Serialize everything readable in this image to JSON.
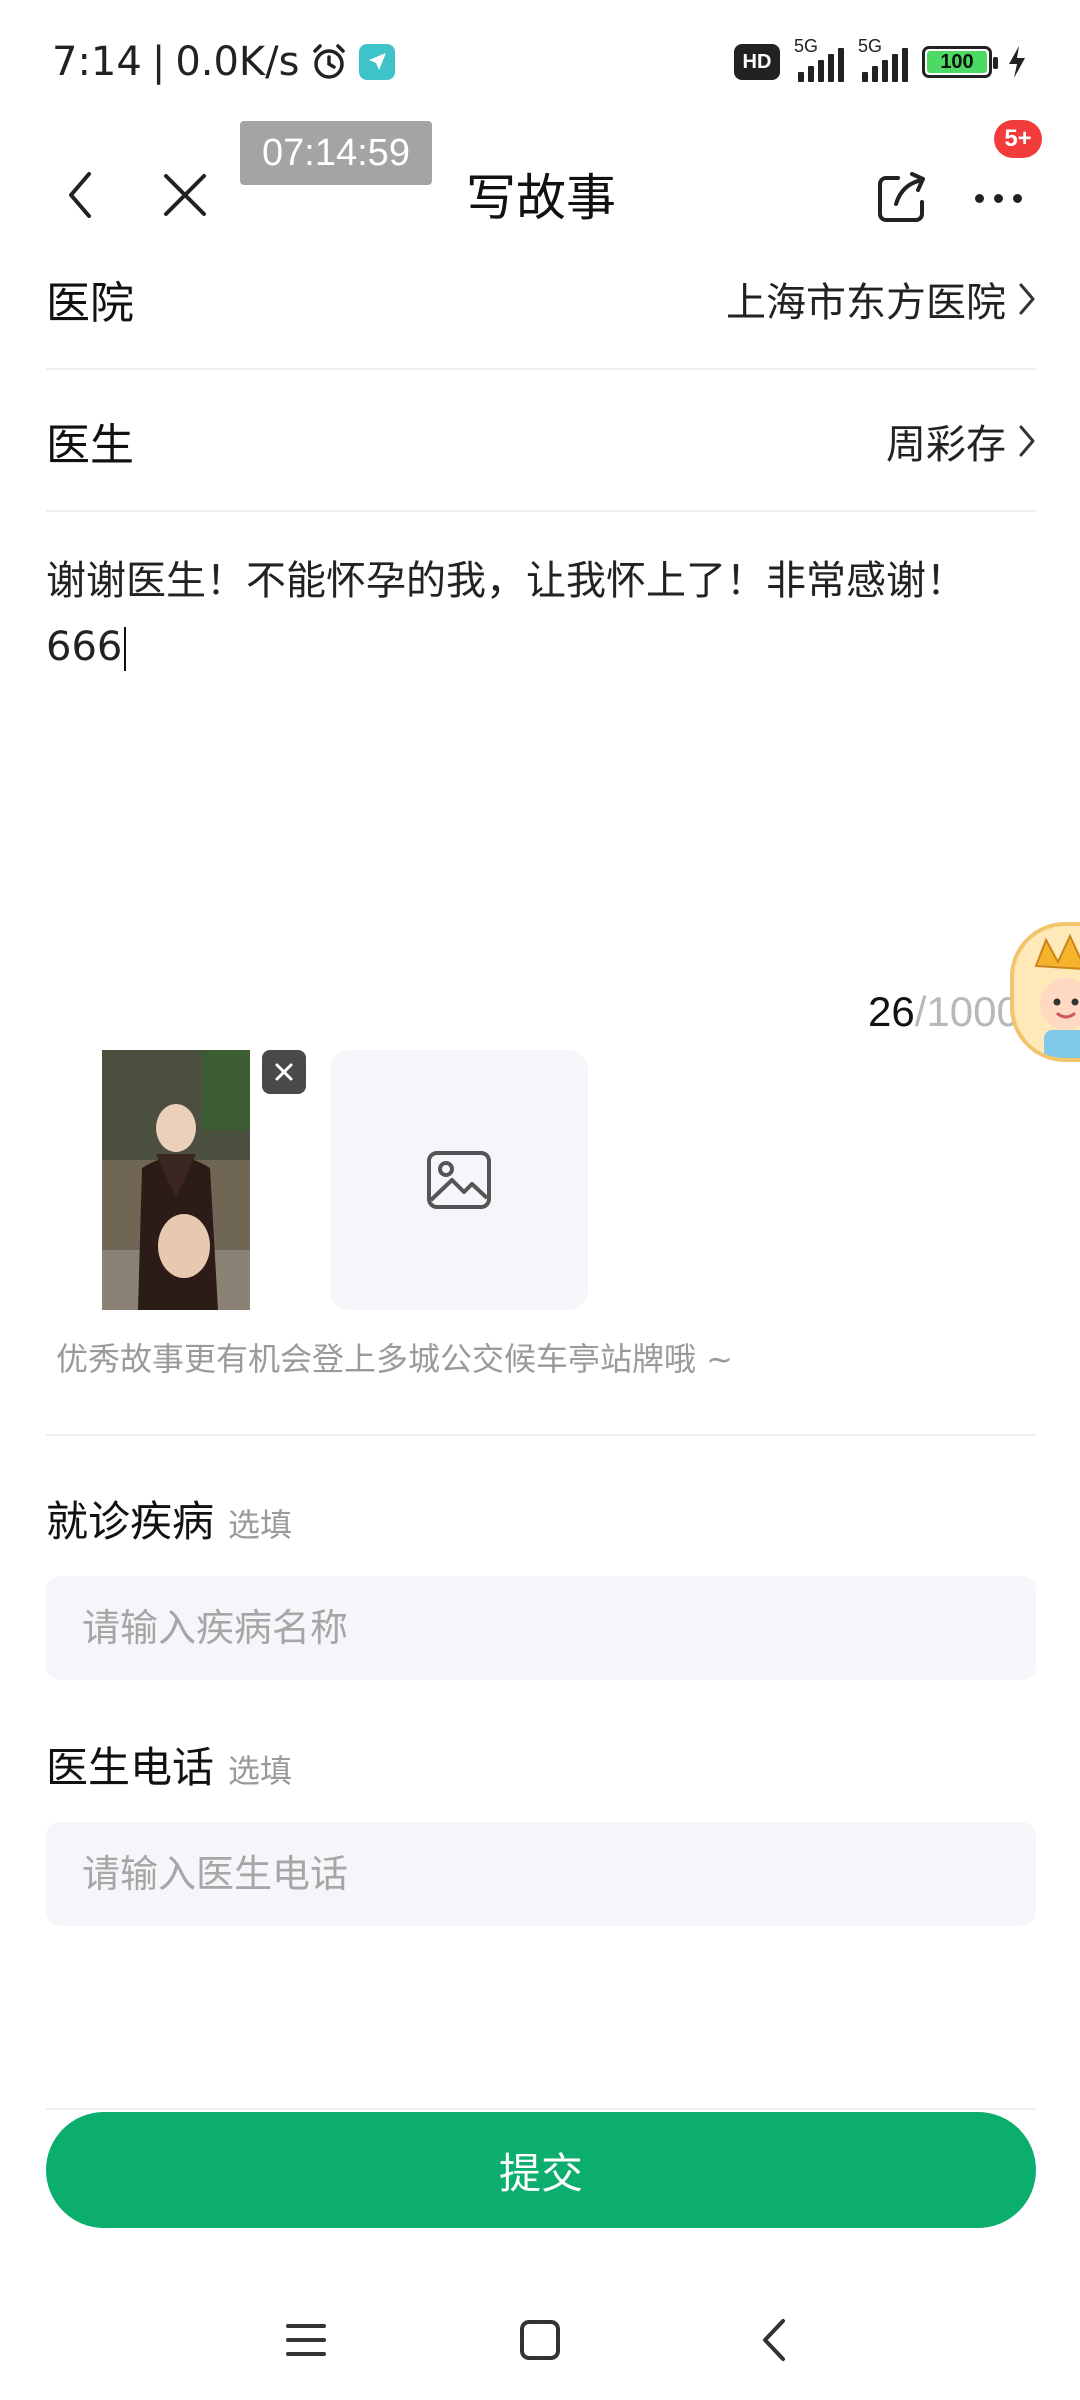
{
  "status_bar": {
    "time": "7:14",
    "separator": "|",
    "net_speed": "0.0K/s",
    "hd_label": "HD",
    "signal1_type": "5G",
    "signal2_type": "5G",
    "battery": "100",
    "alarm_icon": "alarm-clock-icon",
    "location_icon": "location-arrow-icon",
    "charging_icon": "lightning-icon"
  },
  "title_bar": {
    "timer": "07:14:59",
    "title": "写故事",
    "notification_badge": "5+",
    "back_icon": "chevron-left-icon",
    "close_icon": "close-icon",
    "share_icon": "share-icon",
    "more_icon": "more-dots-icon"
  },
  "rows": [
    {
      "label": "医院",
      "value": "上海市东方医院"
    },
    {
      "label": "医生",
      "value": "周彩存"
    }
  ],
  "story": {
    "text": "谢谢医生！不能怀孕的我，让我怀上了！非常感谢！666",
    "count": "26",
    "max": "/1000"
  },
  "images": {
    "hint": "优秀故事更有机会登上多城公交候车亭站牌哦 ~"
  },
  "fields": {
    "disease": {
      "label": "就诊疾病",
      "optional": "选填",
      "placeholder": "请输入疾病名称"
    },
    "phone": {
      "label": "医生电话",
      "optional": "选填",
      "placeholder": "请输入医生电话"
    }
  },
  "submit_label": "提交",
  "colors": {
    "accent": "#0cae6e",
    "badge": "#f23b3b",
    "timer_bg": "#a4a4a4",
    "field_bg": "#f5f6f9"
  }
}
